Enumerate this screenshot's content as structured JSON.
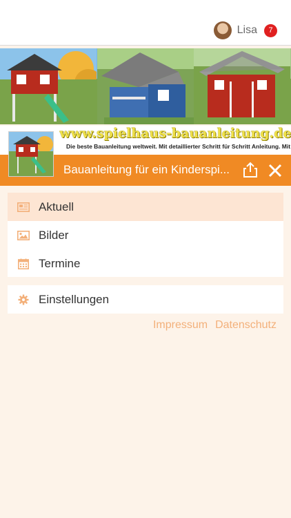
{
  "user": {
    "name": "Lisa",
    "badge_count": "7"
  },
  "site": {
    "url_text": "www.spielhaus-bauanleitung.de",
    "tagline": "Die beste Bauanleitung weltweit. Mit detaillierter Schritt für Schritt Anleitung. Mit Bilder."
  },
  "header": {
    "title": "Bauanleitung für ein Kinderspi..."
  },
  "menu": {
    "items": [
      {
        "label": "Aktuell",
        "icon": "newspaper-icon",
        "active": true
      },
      {
        "label": "Bilder",
        "icon": "image-icon",
        "active": false
      },
      {
        "label": "Termine",
        "icon": "calendar-icon",
        "active": false
      }
    ],
    "settings": {
      "label": "Einstellungen",
      "icon": "gear-icon"
    }
  },
  "footer": {
    "impressum": "Impressum",
    "datenschutz": "Datenschutz"
  },
  "colors": {
    "accent": "#f08a24",
    "active_bg": "#fde5d3",
    "icon": "#f3b07a",
    "link": "#f3b07a",
    "badge": "#e02020"
  }
}
